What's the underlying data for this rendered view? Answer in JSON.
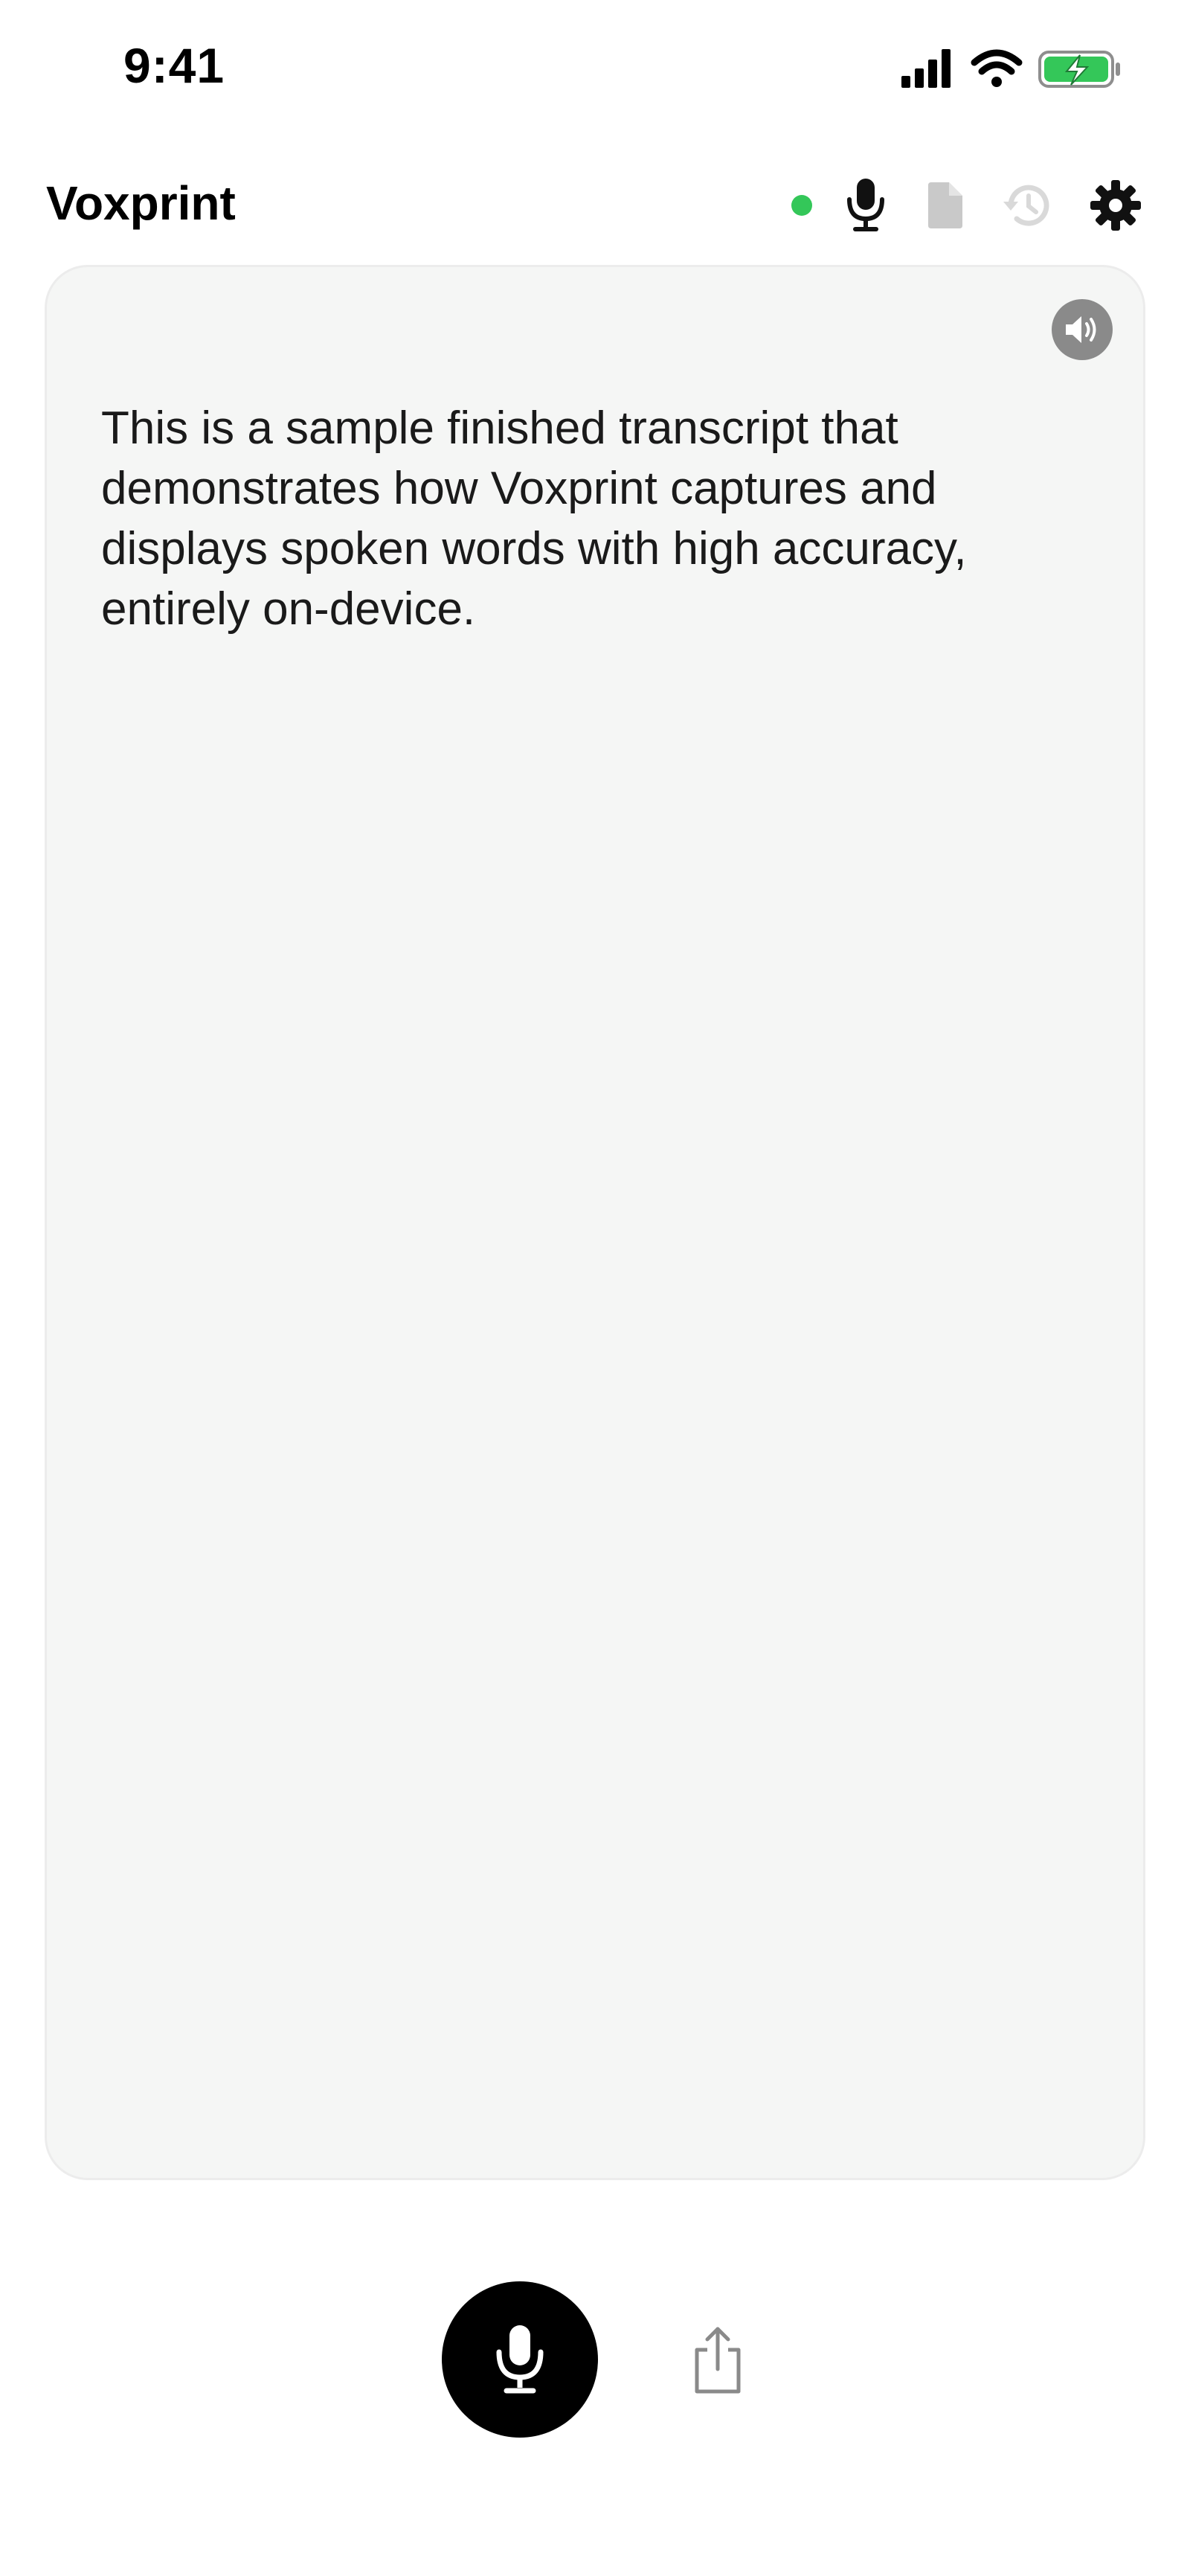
{
  "status_bar": {
    "time": "9:41"
  },
  "header": {
    "title": "Voxprint",
    "status_color": "#34c759"
  },
  "icons": {
    "mic": "microphone-icon",
    "document": "document-icon",
    "history": "history-icon",
    "settings": "gear-icon",
    "speaker": "speaker-icon",
    "share": "share-icon"
  },
  "transcript": {
    "text": "This is a sample finished transcript that demonstrates how Voxprint captures and displays spoken words with high accuracy, entirely on-device."
  },
  "colors": {
    "record_button": "#000000",
    "battery_fill": "#34c759"
  }
}
